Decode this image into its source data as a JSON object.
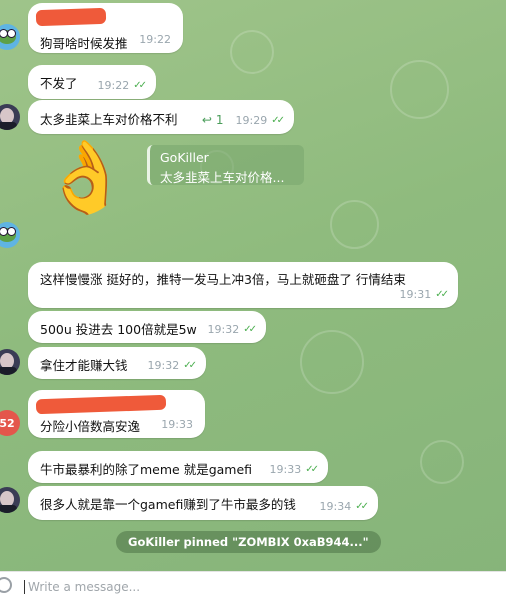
{
  "messages": [
    {
      "text": "狗哥啥时候发推",
      "time": "19:22"
    },
    {
      "text": "不发了",
      "time": "19:22"
    },
    {
      "text": "太多韭菜上车对价格不利",
      "time": "19:29",
      "reply_icon": "↩",
      "reply_count": "1"
    },
    {
      "text": "这样慢慢涨 挺好的，推特一发马上冲3倍，马上就砸盘了 行情结束",
      "time": "19:31"
    },
    {
      "text": "500u 投进去 100倍就是5w",
      "time": "19:32"
    },
    {
      "text": "拿住才能赚大钱",
      "time": "19:32"
    },
    {
      "text": "分险小倍数高安逸",
      "time": "19:33"
    },
    {
      "text": "牛市最暴利的除了meme 就是gamefi",
      "time": "19:33"
    },
    {
      "text": "很多人就是靠一个gamefi赚到了牛市最多的钱",
      "time": "19:34"
    }
  ],
  "quote": {
    "name": "GoKiller",
    "text": "太多韭菜上车对价格..."
  },
  "sticker": {
    "emoji": "👌"
  },
  "avatar_badge": "52",
  "pinned": {
    "text": "GoKiller pinned \"ZOMBIX  0xaB944...\""
  },
  "composer": {
    "placeholder": "Write a message..."
  },
  "colors": {
    "check": "#4caf50",
    "background": "#8fbb7e",
    "pinned_bg": "#5c8454",
    "redaction": "#ef5a3a"
  }
}
